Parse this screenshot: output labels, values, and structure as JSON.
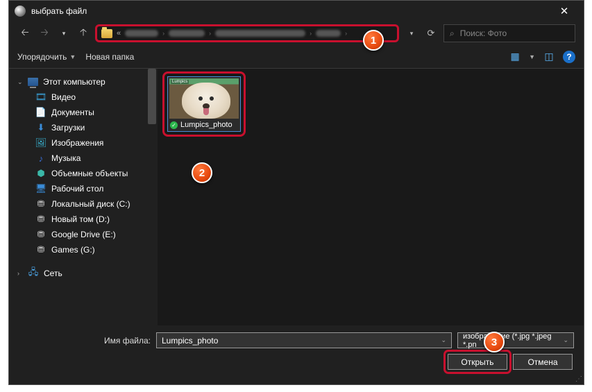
{
  "window": {
    "title": "выбрать файл"
  },
  "nav": {
    "search_placeholder": "Поиск: Фото"
  },
  "toolbar": {
    "organize": "Упорядочить",
    "new_folder": "Новая папка"
  },
  "sidebar": {
    "this_pc": "Этот компьютер",
    "items": [
      {
        "label": "Видео",
        "icon": "video-icon",
        "color": "#3aa0d8"
      },
      {
        "label": "Документы",
        "icon": "documents-icon",
        "color": "#d88a3a"
      },
      {
        "label": "Загрузки",
        "icon": "downloads-icon",
        "color": "#3a8cd8"
      },
      {
        "label": "Изображения",
        "icon": "pictures-icon",
        "color": "#3ab8d8"
      },
      {
        "label": "Музыка",
        "icon": "music-icon",
        "color": "#3a6fd8"
      },
      {
        "label": "Объемные объекты",
        "icon": "objects3d-icon",
        "color": "#3ab8a8"
      },
      {
        "label": "Рабочий стол",
        "icon": "desktop-icon",
        "color": "#3a8cd8"
      },
      {
        "label": "Локальный диск (C:)",
        "icon": "drive-icon",
        "color": "#b8b8b8"
      },
      {
        "label": "Новый том (D:)",
        "icon": "drive-icon",
        "color": "#b8b8b8"
      },
      {
        "label": "Google Drive (E:)",
        "icon": "drive-icon",
        "color": "#b8b8b8"
      },
      {
        "label": "Games (G:)",
        "icon": "drive-icon",
        "color": "#b8b8b8"
      }
    ],
    "network": "Сеть"
  },
  "file": {
    "thumbnail_badge": "Lumpics",
    "name": "Lumpics_photo"
  },
  "footer": {
    "filename_label": "Имя файла:",
    "filename_value": "Lumpics_photo",
    "filter": "изображение (*.jpg *.jpeg *.pn",
    "open": "Открыть",
    "cancel": "Отмена"
  },
  "markers": {
    "m1": "1",
    "m2": "2",
    "m3": "3"
  }
}
